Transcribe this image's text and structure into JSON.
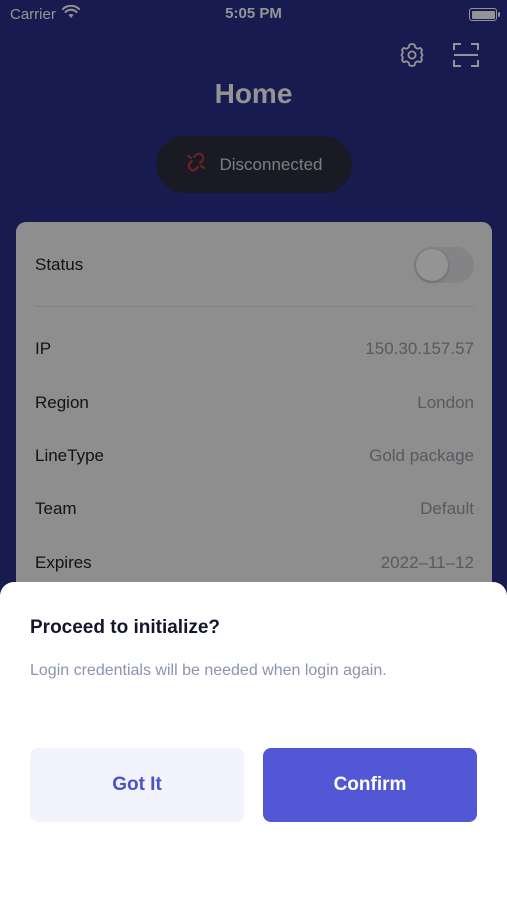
{
  "status_bar": {
    "carrier": "Carrier",
    "time": "5:05 PM"
  },
  "header": {
    "title": "Home",
    "icons": [
      "gear-icon",
      "scan-icon"
    ]
  },
  "connection": {
    "label": "Disconnected",
    "icon": "broken-link-icon",
    "icon_color": "#c43a3a"
  },
  "card": {
    "status_label": "Status",
    "status_on": false,
    "rows": [
      {
        "label": "IP",
        "value": "150.30.157.57"
      },
      {
        "label": "Region",
        "value": "London"
      },
      {
        "label": "LineType",
        "value": "Gold package"
      },
      {
        "label": "Team",
        "value": "Default"
      },
      {
        "label": "Expires",
        "value": "2022–11–12"
      }
    ]
  },
  "dialog": {
    "title": "Proceed to initialize?",
    "message": "Login credentials will be needed when login again.",
    "secondary_button": "Got It",
    "primary_button": "Confirm"
  },
  "colors": {
    "background": "#2a2f8a",
    "primary": "#5257d6",
    "secondary_bg": "#f2f3fc"
  }
}
